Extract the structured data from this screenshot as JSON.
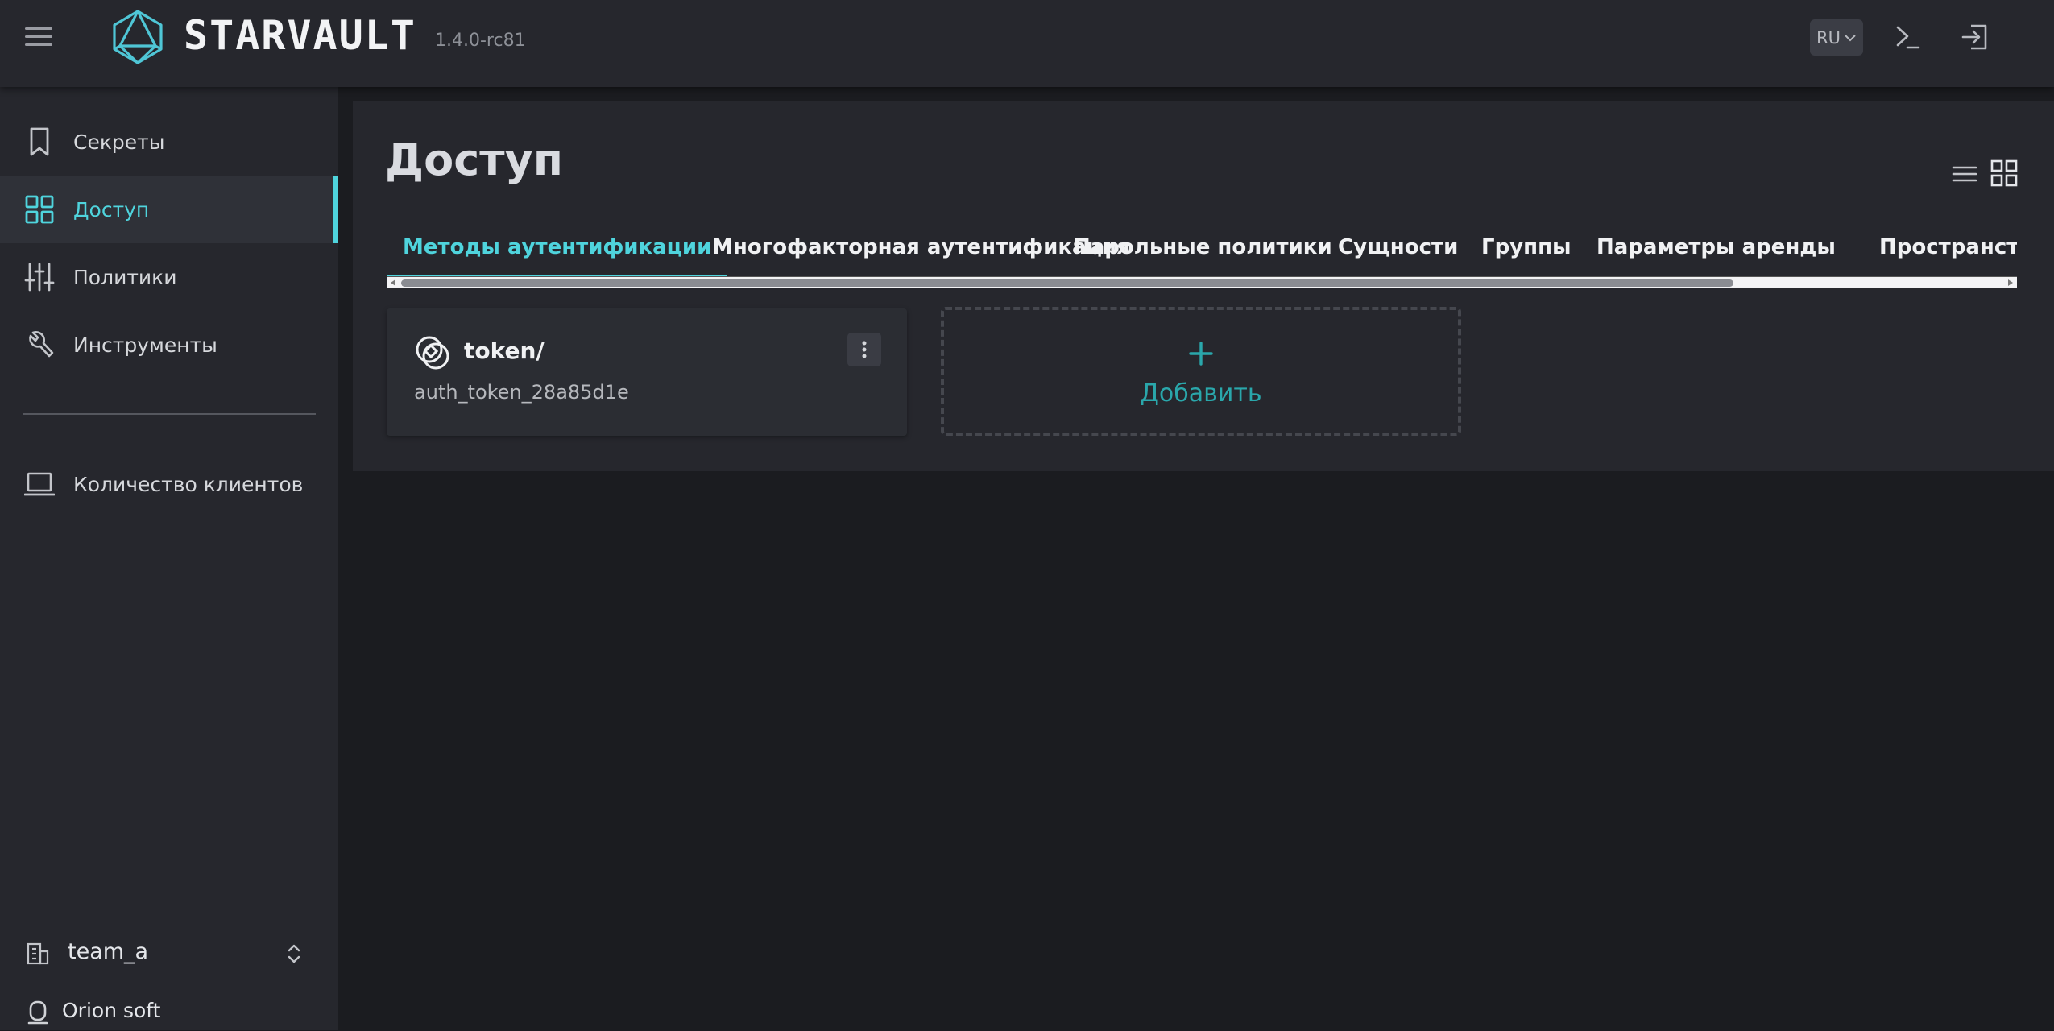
{
  "header": {
    "brand": "STARVAULT",
    "version": "1.4.0-rc81",
    "lang": "RU",
    "icons": [
      "menu-icon",
      "starvault-logo",
      "chevron-down-icon",
      "terminal-icon",
      "logout-icon"
    ]
  },
  "sidebar": {
    "items": [
      {
        "label": "Секреты",
        "icon": "bookmark-icon"
      },
      {
        "label": "Доступ",
        "icon": "grid-icon",
        "active": true
      },
      {
        "label": "Политики",
        "icon": "sliders-icon"
      },
      {
        "label": "Инструменты",
        "icon": "wrench-icon"
      }
    ],
    "clients": {
      "label": "Количество клиентов",
      "icon": "laptop-icon"
    },
    "namespace": {
      "label": "team_a",
      "icon": "building-icon"
    },
    "org": {
      "label": "Orion soft",
      "icon": "orion-logo-icon"
    }
  },
  "main": {
    "title": "Доступ",
    "tabs": [
      "Методы аутентификации",
      "Многофакторная аутентификация",
      "Парольные политики",
      "Сущности",
      "Группы",
      "Параметры аренды",
      "Пространства имён"
    ],
    "active_tab": 0,
    "auth_methods": [
      {
        "name": "token/",
        "accessor": "auth_token_28a85d1e",
        "icon": "token-icon"
      }
    ],
    "add_label": "Добавить"
  },
  "colors": {
    "accent": "#4fd4dd",
    "add_text": "#2aa7ab",
    "panel": "#26272d",
    "background": "#1b1c20"
  }
}
